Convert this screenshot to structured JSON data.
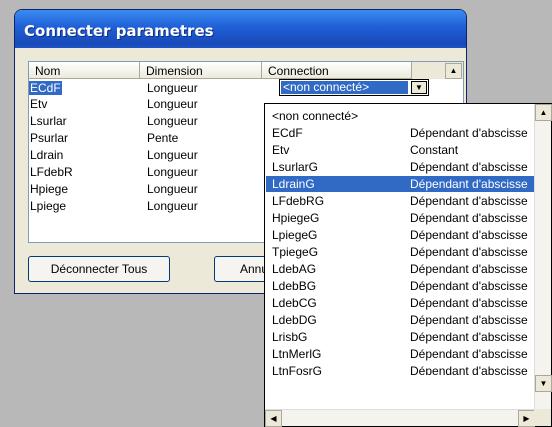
{
  "dialog": {
    "title": "Connecter parametres"
  },
  "table": {
    "columns": [
      "Nom",
      "Dimension",
      "Connection"
    ],
    "rows": [
      {
        "nom": "ECdF",
        "dimension": "Longueur"
      },
      {
        "nom": "Etv",
        "dimension": "Longueur"
      },
      {
        "nom": "Lsurlar",
        "dimension": "Longueur"
      },
      {
        "nom": "Psurlar",
        "dimension": "Pente"
      },
      {
        "nom": "Ldrain",
        "dimension": "Longueur"
      },
      {
        "nom": "LFdebR",
        "dimension": "Longueur"
      },
      {
        "nom": "Hpiege",
        "dimension": "Longueur"
      },
      {
        "nom": "Lpiege",
        "dimension": "Longueur"
      }
    ]
  },
  "combo": {
    "value": "<non connecté>"
  },
  "buttons": {
    "disconnect_all": "Déconnecter Tous",
    "cancel": "Annu"
  },
  "dropdown": {
    "items": [
      {
        "name": "<non connecté>",
        "type": ""
      },
      {
        "name": "ECdF",
        "type": "Dépendant d'abscisse"
      },
      {
        "name": "Etv",
        "type": "Constant"
      },
      {
        "name": "LsurlarG",
        "type": "Dépendant d'abscisse"
      },
      {
        "name": "LdrainG",
        "type": "Dépendant d'abscisse"
      },
      {
        "name": "LFdebRG",
        "type": "Dépendant d'abscisse"
      },
      {
        "name": "HpiegeG",
        "type": "Dépendant d'abscisse"
      },
      {
        "name": "LpiegeG",
        "type": "Dépendant d'abscisse"
      },
      {
        "name": "TpiegeG",
        "type": "Dépendant d'abscisse"
      },
      {
        "name": "LdebAG",
        "type": "Dépendant d'abscisse"
      },
      {
        "name": "LdebBG",
        "type": "Dépendant d'abscisse"
      },
      {
        "name": "LdebCG",
        "type": "Dépendant d'abscisse"
      },
      {
        "name": "LdebDG",
        "type": "Dépendant d'abscisse"
      },
      {
        "name": "LrisbG",
        "type": "Dépendant d'abscisse"
      },
      {
        "name": "LtnMerlG",
        "type": "Dépendant d'abscisse"
      },
      {
        "name": "LtnFosrG",
        "type": "Dépendant d'abscisse"
      }
    ],
    "selected_index": 4
  },
  "icons": {
    "up": "▲",
    "down": "▼",
    "left": "◀",
    "right": "▶"
  }
}
